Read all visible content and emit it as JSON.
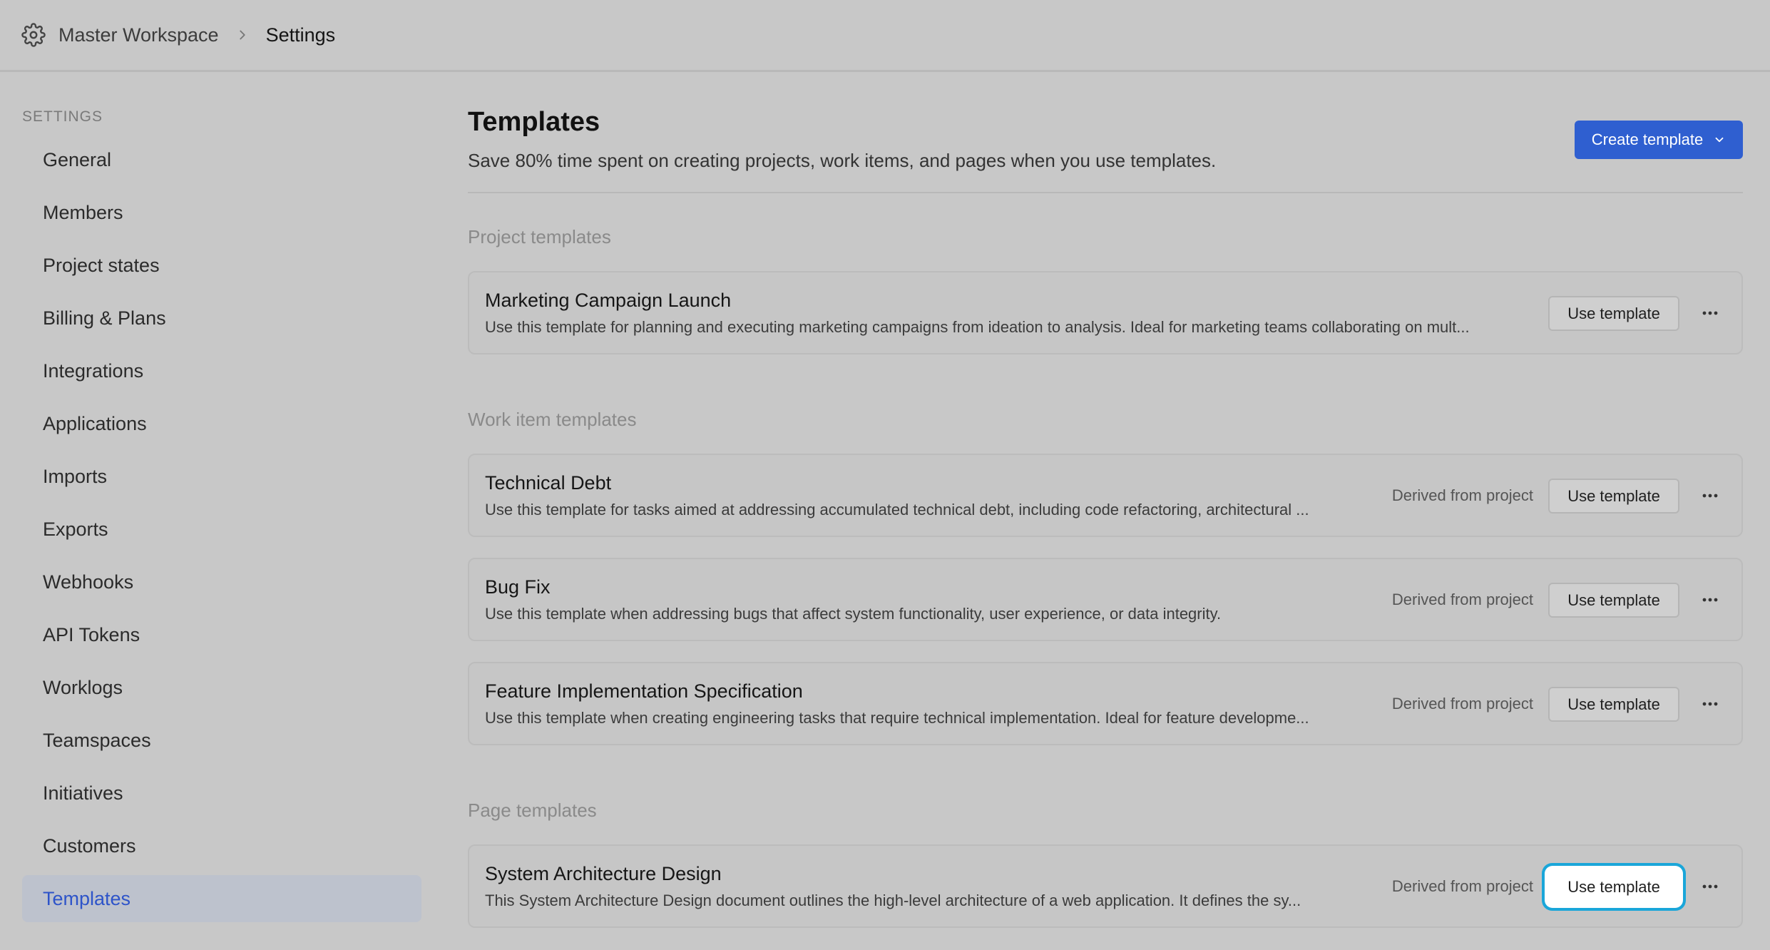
{
  "breadcrumb": {
    "workspace": "Master Workspace",
    "current": "Settings"
  },
  "sidebar": {
    "section_label": "SETTINGS",
    "items": [
      {
        "label": "General"
      },
      {
        "label": "Members"
      },
      {
        "label": "Project states"
      },
      {
        "label": "Billing & Plans"
      },
      {
        "label": "Integrations"
      },
      {
        "label": "Applications"
      },
      {
        "label": "Imports"
      },
      {
        "label": "Exports"
      },
      {
        "label": "Webhooks"
      },
      {
        "label": "API Tokens"
      },
      {
        "label": "Worklogs"
      },
      {
        "label": "Teamspaces"
      },
      {
        "label": "Initiatives"
      },
      {
        "label": "Customers"
      },
      {
        "label": "Templates",
        "active": true
      }
    ]
  },
  "header": {
    "title": "Templates",
    "subtitle": "Save 80% time spent on creating projects, work items, and pages when you use templates.",
    "create_label": "Create template"
  },
  "groups": {
    "project": {
      "title": "Project templates",
      "items": [
        {
          "name": "Marketing Campaign Launch",
          "description": "Use this template for planning and executing marketing campaigns from ideation to analysis. Ideal for marketing teams collaborating on mult...",
          "use_label": "Use template"
        }
      ]
    },
    "work_item": {
      "title": "Work item templates",
      "items": [
        {
          "name": "Technical Debt",
          "description": "Use this template for tasks aimed at addressing accumulated technical debt, including code refactoring, architectural ...",
          "derived": "Derived from project",
          "use_label": "Use template"
        },
        {
          "name": "Bug Fix",
          "description": "Use this template when addressing bugs that affect system functionality, user experience, or data integrity.",
          "derived": "Derived from project",
          "use_label": "Use template"
        },
        {
          "name": "Feature Implementation Specification",
          "description": "Use this template when creating engineering tasks that require technical implementation. Ideal for feature developme...",
          "derived": "Derived from project",
          "use_label": "Use template"
        }
      ]
    },
    "page": {
      "title": "Page templates",
      "items": [
        {
          "name": "System Architecture Design",
          "description": "This System Architecture Design document outlines the high-level architecture of a web application. It defines the sy...",
          "derived": "Derived from project",
          "use_label": "Use template",
          "focused": true
        }
      ]
    }
  },
  "icons": {
    "workspace": "gear-icon",
    "separator": "chevron-right-icon",
    "dropdown": "chevron-down-icon",
    "more": "more-horizontal-icon"
  },
  "colors": {
    "accent": "#2f5fd0",
    "active_item_bg": "#bdc2cd",
    "active_item_text": "#2e54c9",
    "focus_ring": "#1aa6d9"
  }
}
